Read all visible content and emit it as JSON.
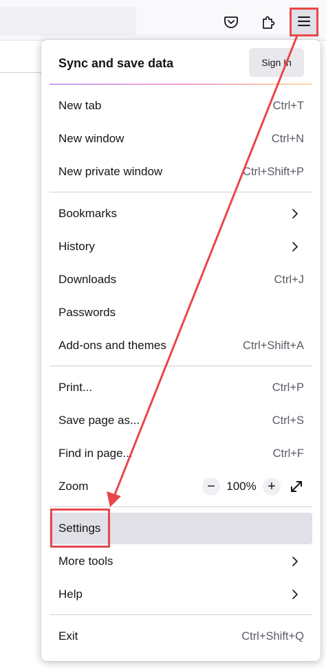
{
  "colors": {
    "annotation": "#e8464c",
    "highlight": "#e0e0e6",
    "accent_gradient": [
      "#9059ff",
      "#ff4aa2",
      "#ffbd4f"
    ]
  },
  "toolbar": {
    "icons": [
      "pocket-icon",
      "extensions-icon",
      "hamburger-menu-icon"
    ]
  },
  "menu": {
    "sync_title": "Sync and save data",
    "sign_in": "Sign In",
    "items": {
      "new_tab": {
        "label": "New tab",
        "shortcut": "Ctrl+T"
      },
      "new_window": {
        "label": "New window",
        "shortcut": "Ctrl+N"
      },
      "new_private": {
        "label": "New private window",
        "shortcut": "Ctrl+Shift+P"
      },
      "bookmarks": {
        "label": "Bookmarks"
      },
      "history": {
        "label": "History"
      },
      "downloads": {
        "label": "Downloads",
        "shortcut": "Ctrl+J"
      },
      "passwords": {
        "label": "Passwords"
      },
      "addons": {
        "label": "Add-ons and themes",
        "shortcut": "Ctrl+Shift+A"
      },
      "print": {
        "label": "Print...",
        "shortcut": "Ctrl+P"
      },
      "save_page": {
        "label": "Save page as...",
        "shortcut": "Ctrl+S"
      },
      "find": {
        "label": "Find in page...",
        "shortcut": "Ctrl+F"
      },
      "zoom": {
        "label": "Zoom",
        "value": "100%",
        "minus": "−",
        "plus": "+"
      },
      "settings": {
        "label": "Settings"
      },
      "more_tools": {
        "label": "More tools"
      },
      "help": {
        "label": "Help"
      },
      "exit": {
        "label": "Exit",
        "shortcut": "Ctrl+Shift+Q"
      }
    }
  }
}
